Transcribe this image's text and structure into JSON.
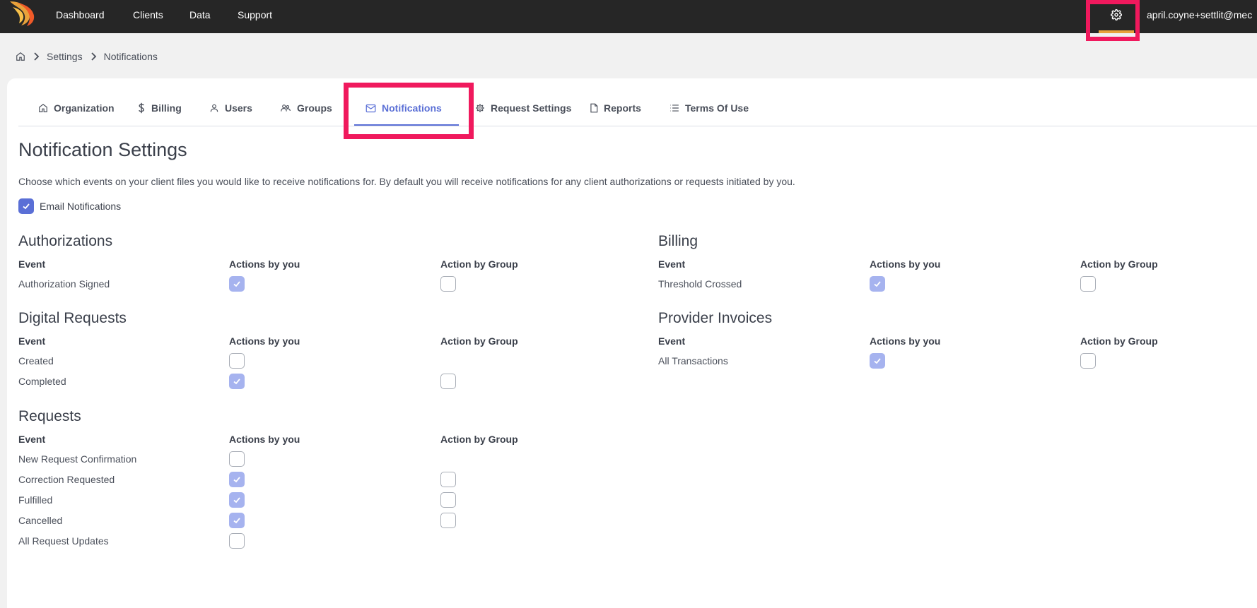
{
  "nav": {
    "items": [
      "Dashboard",
      "Clients",
      "Data",
      "Support"
    ],
    "user_email": "april.coyne+settlit@mec"
  },
  "breadcrumb": [
    "Settings",
    "Notifications"
  ],
  "tabs": [
    {
      "label": "Organization",
      "icon": "home-icon"
    },
    {
      "label": "Billing",
      "icon": "dollar-icon"
    },
    {
      "label": "Users",
      "icon": "user-icon"
    },
    {
      "label": "Groups",
      "icon": "group-icon"
    },
    {
      "label": "Notifications",
      "icon": "mail-icon",
      "active": true
    },
    {
      "label": "Request Settings",
      "icon": "gear-icon"
    },
    {
      "label": "Reports",
      "icon": "file-icon"
    },
    {
      "label": "Terms Of Use",
      "icon": "list-icon"
    }
  ],
  "page": {
    "title": "Notification Settings",
    "description": "Choose which events on your client files you would like to receive notifications for. By default you will receive notifications for any client authorizations or requests initiated by you.",
    "email_notifications_label": "Email Notifications",
    "email_notifications_checked": true
  },
  "columns": {
    "event": "Event",
    "by_you": "Actions by you",
    "by_group": "Action by Group"
  },
  "sections": {
    "authorizations": {
      "title": "Authorizations",
      "rows": [
        {
          "label": "Authorization Signed",
          "by_you": true,
          "by_group": false
        }
      ]
    },
    "billing": {
      "title": "Billing",
      "rows": [
        {
          "label": "Threshold Crossed",
          "by_you": true,
          "by_group": false
        }
      ]
    },
    "digital_requests": {
      "title": "Digital Requests",
      "rows": [
        {
          "label": "Created",
          "by_you": false,
          "by_group": null
        },
        {
          "label": "Completed",
          "by_you": true,
          "by_group": false
        }
      ]
    },
    "provider_invoices": {
      "title": "Provider Invoices",
      "rows": [
        {
          "label": "All Transactions",
          "by_you": true,
          "by_group": false
        }
      ]
    },
    "requests": {
      "title": "Requests",
      "rows": [
        {
          "label": "New Request Confirmation",
          "by_you": false,
          "by_group": null
        },
        {
          "label": "Correction Requested",
          "by_you": true,
          "by_group": false
        },
        {
          "label": "Fulfilled",
          "by_you": true,
          "by_group": false
        },
        {
          "label": "Cancelled",
          "by_you": true,
          "by_group": false
        },
        {
          "label": "All Request Updates",
          "by_you": false,
          "by_group": null
        }
      ]
    }
  },
  "colors": {
    "accent": "#5a6fd6",
    "highlight": "#f0195d",
    "topbar": "#262626",
    "checked_disabled": "#a6b3ef"
  }
}
